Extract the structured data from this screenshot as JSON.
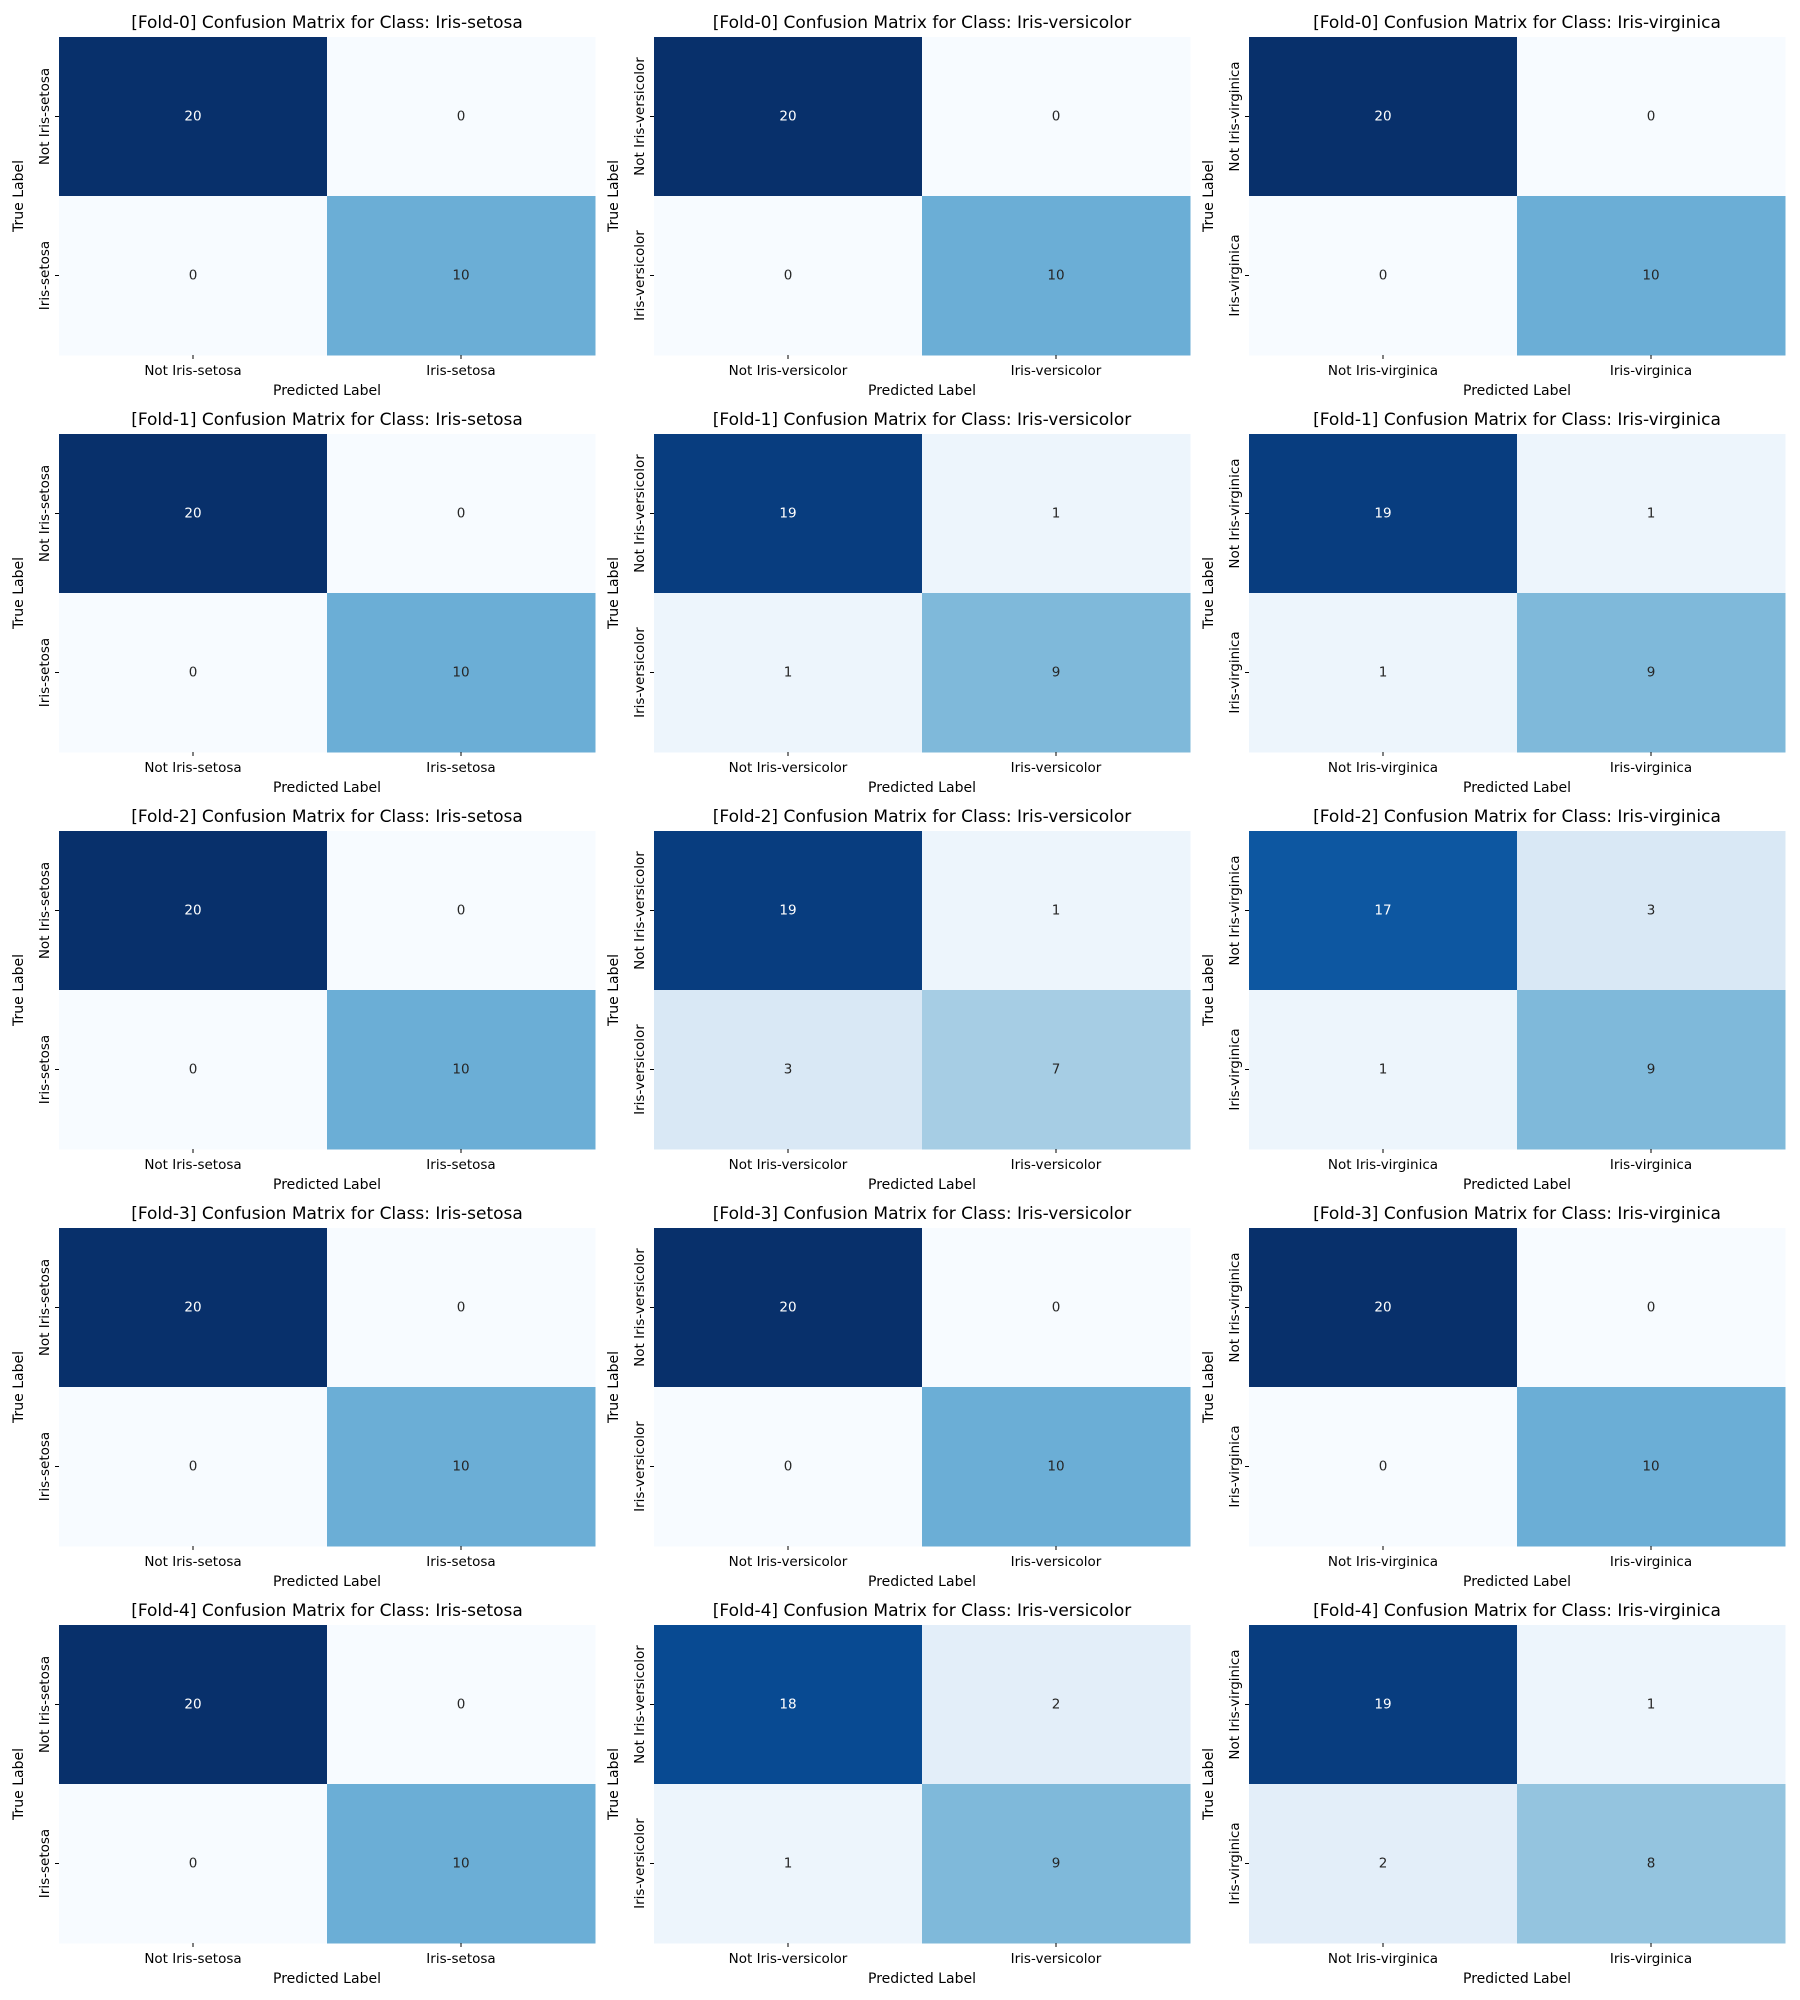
{
  "figure": {
    "colormap": "Blues",
    "vmin": 0,
    "vmax": 20,
    "colorbar": false
  },
  "chart_data": [
    {
      "type": "heatmap",
      "fold": 0,
      "title": "[Fold-0] Confusion Matrix for Class: Iris-setosa",
      "xlabel": "Predicted Label",
      "ylabel": "True Label",
      "x_tick_labels": [
        "Not Iris-setosa",
        "Iris-setosa"
      ],
      "y_tick_labels": [
        "Not Iris-setosa",
        "Iris-setosa"
      ],
      "values": [
        [
          20,
          0
        ],
        [
          0,
          10
        ]
      ]
    },
    {
      "type": "heatmap",
      "fold": 0,
      "title": "[Fold-0] Confusion Matrix for Class: Iris-versicolor",
      "xlabel": "Predicted Label",
      "ylabel": "True Label",
      "x_tick_labels": [
        "Not Iris-versicolor",
        "Iris-versicolor"
      ],
      "y_tick_labels": [
        "Not Iris-versicolor",
        "Iris-versicolor"
      ],
      "values": [
        [
          20,
          0
        ],
        [
          0,
          10
        ]
      ]
    },
    {
      "type": "heatmap",
      "fold": 0,
      "title": "[Fold-0] Confusion Matrix for Class: Iris-virginica",
      "xlabel": "Predicted Label",
      "ylabel": "True Label",
      "x_tick_labels": [
        "Not Iris-virginica",
        "Iris-virginica"
      ],
      "y_tick_labels": [
        "Not Iris-virginica",
        "Iris-virginica"
      ],
      "values": [
        [
          20,
          0
        ],
        [
          0,
          10
        ]
      ]
    },
    {
      "type": "heatmap",
      "fold": 1,
      "title": "[Fold-1] Confusion Matrix for Class: Iris-setosa",
      "xlabel": "Predicted Label",
      "ylabel": "True Label",
      "x_tick_labels": [
        "Not Iris-setosa",
        "Iris-setosa"
      ],
      "y_tick_labels": [
        "Not Iris-setosa",
        "Iris-setosa"
      ],
      "values": [
        [
          20,
          0
        ],
        [
          0,
          10
        ]
      ]
    },
    {
      "type": "heatmap",
      "fold": 1,
      "title": "[Fold-1] Confusion Matrix for Class: Iris-versicolor",
      "xlabel": "Predicted Label",
      "ylabel": "True Label",
      "x_tick_labels": [
        "Not Iris-versicolor",
        "Iris-versicolor"
      ],
      "y_tick_labels": [
        "Not Iris-versicolor",
        "Iris-versicolor"
      ],
      "values": [
        [
          19,
          1
        ],
        [
          1,
          9
        ]
      ]
    },
    {
      "type": "heatmap",
      "fold": 1,
      "title": "[Fold-1] Confusion Matrix for Class: Iris-virginica",
      "xlabel": "Predicted Label",
      "ylabel": "True Label",
      "x_tick_labels": [
        "Not Iris-virginica",
        "Iris-virginica"
      ],
      "y_tick_labels": [
        "Not Iris-virginica",
        "Iris-virginica"
      ],
      "values": [
        [
          19,
          1
        ],
        [
          1,
          9
        ]
      ]
    },
    {
      "type": "heatmap",
      "fold": 2,
      "title": "[Fold-2] Confusion Matrix for Class: Iris-setosa",
      "xlabel": "Predicted Label",
      "ylabel": "True Label",
      "x_tick_labels": [
        "Not Iris-setosa",
        "Iris-setosa"
      ],
      "y_tick_labels": [
        "Not Iris-setosa",
        "Iris-setosa"
      ],
      "values": [
        [
          20,
          0
        ],
        [
          0,
          10
        ]
      ]
    },
    {
      "type": "heatmap",
      "fold": 2,
      "title": "[Fold-2] Confusion Matrix for Class: Iris-versicolor",
      "xlabel": "Predicted Label",
      "ylabel": "True Label",
      "x_tick_labels": [
        "Not Iris-versicolor",
        "Iris-versicolor"
      ],
      "y_tick_labels": [
        "Not Iris-versicolor",
        "Iris-versicolor"
      ],
      "values": [
        [
          19,
          1
        ],
        [
          3,
          7
        ]
      ]
    },
    {
      "type": "heatmap",
      "fold": 2,
      "title": "[Fold-2] Confusion Matrix for Class: Iris-virginica",
      "xlabel": "Predicted Label",
      "ylabel": "True Label",
      "x_tick_labels": [
        "Not Iris-virginica",
        "Iris-virginica"
      ],
      "y_tick_labels": [
        "Not Iris-virginica",
        "Iris-virginica"
      ],
      "values": [
        [
          17,
          3
        ],
        [
          1,
          9
        ]
      ]
    },
    {
      "type": "heatmap",
      "fold": 3,
      "title": "[Fold-3] Confusion Matrix for Class: Iris-setosa",
      "xlabel": "Predicted Label",
      "ylabel": "True Label",
      "x_tick_labels": [
        "Not Iris-setosa",
        "Iris-setosa"
      ],
      "y_tick_labels": [
        "Not Iris-setosa",
        "Iris-setosa"
      ],
      "values": [
        [
          20,
          0
        ],
        [
          0,
          10
        ]
      ]
    },
    {
      "type": "heatmap",
      "fold": 3,
      "title": "[Fold-3] Confusion Matrix for Class: Iris-versicolor",
      "xlabel": "Predicted Label",
      "ylabel": "True Label",
      "x_tick_labels": [
        "Not Iris-versicolor",
        "Iris-versicolor"
      ],
      "y_tick_labels": [
        "Not Iris-versicolor",
        "Iris-versicolor"
      ],
      "values": [
        [
          20,
          0
        ],
        [
          0,
          10
        ]
      ]
    },
    {
      "type": "heatmap",
      "fold": 3,
      "title": "[Fold-3] Confusion Matrix for Class: Iris-virginica",
      "xlabel": "Predicted Label",
      "ylabel": "True Label",
      "x_tick_labels": [
        "Not Iris-virginica",
        "Iris-virginica"
      ],
      "y_tick_labels": [
        "Not Iris-virginica",
        "Iris-virginica"
      ],
      "values": [
        [
          20,
          0
        ],
        [
          0,
          10
        ]
      ]
    },
    {
      "type": "heatmap",
      "fold": 4,
      "title": "[Fold-4] Confusion Matrix for Class: Iris-setosa",
      "xlabel": "Predicted Label",
      "ylabel": "True Label",
      "x_tick_labels": [
        "Not Iris-setosa",
        "Iris-setosa"
      ],
      "y_tick_labels": [
        "Not Iris-setosa",
        "Iris-setosa"
      ],
      "values": [
        [
          20,
          0
        ],
        [
          0,
          10
        ]
      ]
    },
    {
      "type": "heatmap",
      "fold": 4,
      "title": "[Fold-4] Confusion Matrix for Class: Iris-versicolor",
      "xlabel": "Predicted Label",
      "ylabel": "True Label",
      "x_tick_labels": [
        "Not Iris-versicolor",
        "Iris-versicolor"
      ],
      "y_tick_labels": [
        "Not Iris-versicolor",
        "Iris-versicolor"
      ],
      "values": [
        [
          18,
          2
        ],
        [
          1,
          9
        ]
      ]
    },
    {
      "type": "heatmap",
      "fold": 4,
      "title": "[Fold-4] Confusion Matrix for Class: Iris-virginica",
      "xlabel": "Predicted Label",
      "ylabel": "True Label",
      "x_tick_labels": [
        "Not Iris-virginica",
        "Iris-virginica"
      ],
      "y_tick_labels": [
        "Not Iris-virginica",
        "Iris-virginica"
      ],
      "values": [
        [
          19,
          1
        ],
        [
          2,
          8
        ]
      ]
    }
  ]
}
